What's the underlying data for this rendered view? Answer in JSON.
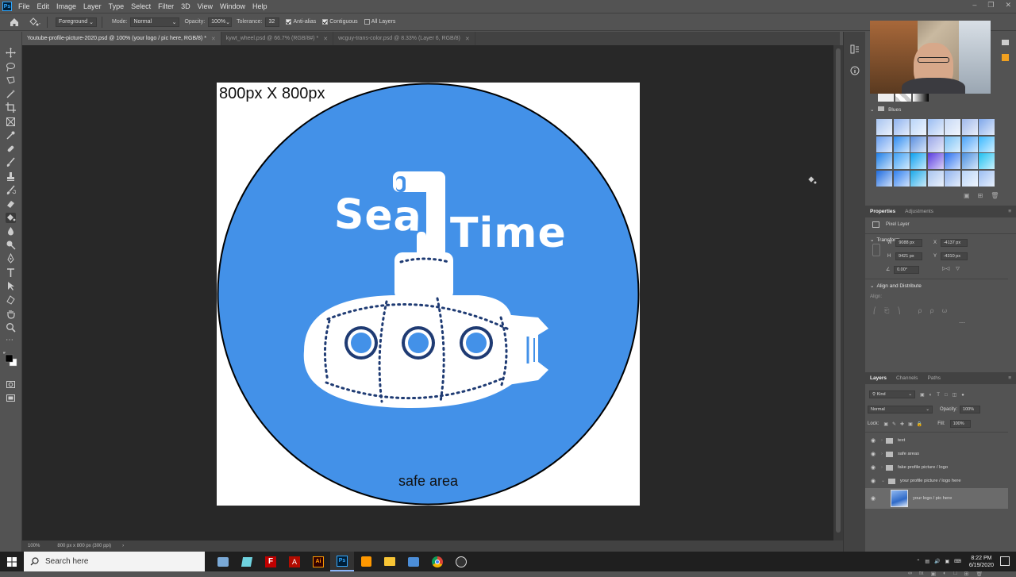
{
  "menubar": {
    "logo_text": "Ps",
    "items": [
      "File",
      "Edit",
      "Image",
      "Layer",
      "Type",
      "Select",
      "Filter",
      "3D",
      "View",
      "Window",
      "Help"
    ]
  },
  "options": {
    "fill_source": "Foreground",
    "mode_label": "Mode:",
    "mode_value": "Normal",
    "opacity_label": "Opacity:",
    "opacity_value": "100%",
    "tolerance_label": "Tolerance:",
    "tolerance_value": "32",
    "antialias_label": "Anti-alias",
    "contiguous_label": "Contiguous",
    "alllayers_label": "All Layers"
  },
  "tabs": [
    {
      "label": "Youtube-profile-picture-2020.psd @ 100% (your logo / pic here, RGB/8) *",
      "active": true
    },
    {
      "label": "kywt_wheel.psd @ 66.7% (RGB/8#) *",
      "active": false
    },
    {
      "label": "wcguy-trans-color.psd @ 8.33% (Layer 6, RGB/8)",
      "active": false
    }
  ],
  "document": {
    "size_label": "800px X 800px",
    "safe_area_label": "safe area",
    "logo_word1": "Sea",
    "logo_word2": "Time"
  },
  "status": {
    "zoom": "100%",
    "doc_info": "800 px x 800 px (300 ppi)"
  },
  "swatches": {
    "group_name": "Blues"
  },
  "properties": {
    "tab_properties": "Properties",
    "tab_adjustments": "Adjustments",
    "layer_type": "Pixel Layer",
    "transform_title": "Transform",
    "w_label": "W",
    "w_value": "9088 px",
    "x_label": "X",
    "x_value": "-4137 px",
    "h_label": "H",
    "h_value": "9421 px",
    "y_label": "Y",
    "y_value": "-4310 px",
    "angle_value": "0.00°",
    "align_title": "Align and Distribute",
    "align_label": "Align:"
  },
  "layers": {
    "tab_layers": "Layers",
    "tab_channels": "Channels",
    "tab_paths": "Paths",
    "filter_kind": "Kind",
    "blend_mode": "Normal",
    "opacity_label": "Opacity:",
    "opacity_value": "100%",
    "lock_label": "Lock:",
    "fill_label": "Fill:",
    "fill_value": "100%",
    "items": [
      {
        "name": "text",
        "type": "group"
      },
      {
        "name": "safe areas",
        "type": "group"
      },
      {
        "name": "fake profile picture / logo",
        "type": "group"
      },
      {
        "name": "your profile picture / logo here",
        "type": "group-open"
      },
      {
        "name": "your logo / pic here",
        "type": "layer",
        "selected": true
      }
    ]
  },
  "taskbar": {
    "search_placeholder": "Search here",
    "time": "8:22 PM",
    "date": "6/19/2020"
  },
  "colors": {
    "circle_blue": "#4391e8",
    "navy": "#1f3b73",
    "accent_blue": "#31a8ff"
  }
}
